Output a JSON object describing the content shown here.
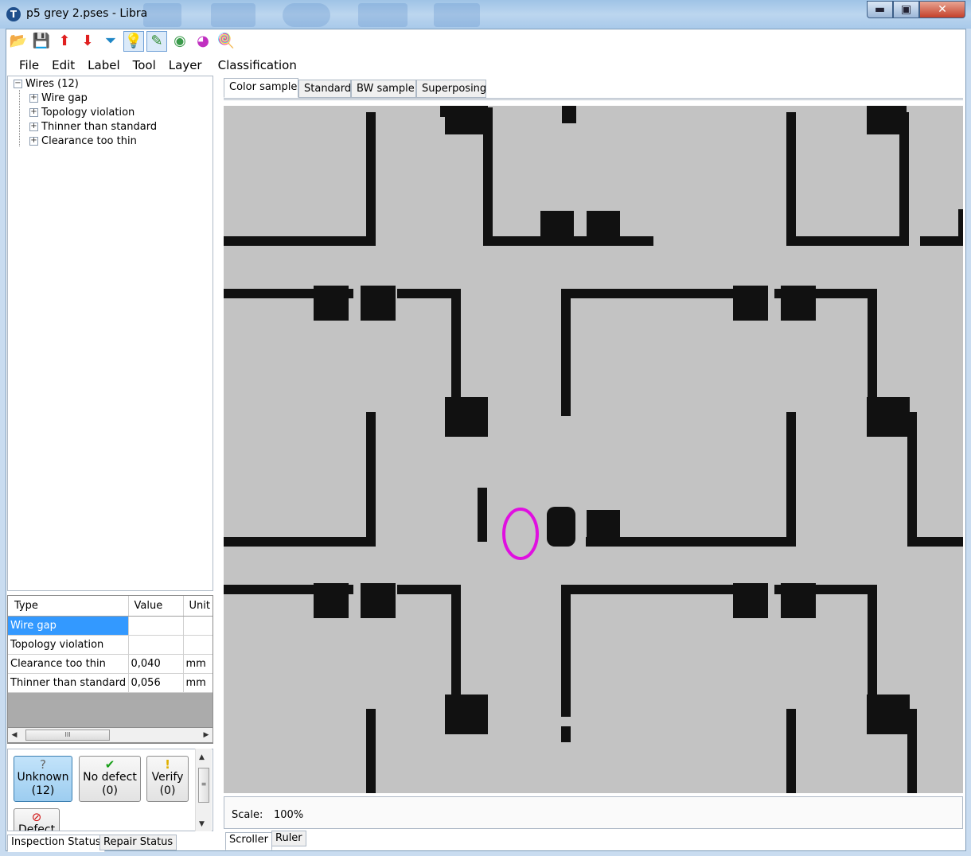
{
  "window": {
    "title": "p5 grey 2.pses - Libra",
    "min_glyph": "▬",
    "max_glyph": "▣",
    "close_glyph": "✕"
  },
  "toolbar": [
    {
      "icon": "open-folder-icon",
      "glyph": "📂",
      "color": "#e0a100"
    },
    {
      "icon": "save-icon",
      "glyph": "💾",
      "color": "#333"
    },
    {
      "icon": "arrow-up-icon",
      "glyph": "⬆",
      "color": "#e02020"
    },
    {
      "icon": "arrow-down-icon",
      "glyph": "⬇",
      "color": "#e02020"
    },
    {
      "icon": "filter-icon",
      "glyph": "⏷",
      "color": "#1e86c6"
    },
    {
      "icon": "lightbulb-icon",
      "glyph": "💡",
      "color": "#e6b800",
      "active": true
    },
    {
      "icon": "pencil-icon",
      "glyph": "✎",
      "color": "#2e8b2e",
      "active": true
    },
    {
      "icon": "color-circles-icon",
      "glyph": "◉",
      "color": "#3a9a4a"
    },
    {
      "icon": "color-wheel-icon",
      "glyph": "◕",
      "color": "#c030c0"
    },
    {
      "icon": "lollipop-icon",
      "glyph": "🍭",
      "color": "#d03030"
    }
  ],
  "menu": [
    "File",
    "Edit",
    "Label",
    "Tool",
    "Layer",
    "Classification"
  ],
  "tree": {
    "root": "Wires (12)",
    "children": [
      "Wire gap",
      "Topology violation",
      "Thinner than standard",
      "Clearance too thin"
    ]
  },
  "props": {
    "headers": [
      "Type",
      "Value",
      "Unit"
    ],
    "rows": [
      [
        "Wire gap",
        "",
        ""
      ],
      [
        "Topology violation",
        "",
        ""
      ],
      [
        "Clearance too thin",
        "0,040",
        "mm"
      ],
      [
        "Thinner than standard",
        "0,056",
        "mm"
      ]
    ],
    "scroll_grip": "III"
  },
  "status_buttons": {
    "unknown": {
      "label": "Unknown",
      "count": "(12)",
      "icon": "question-icon",
      "glyph": "?"
    },
    "no_defect": {
      "label": "No defect",
      "count": "(0)",
      "icon": "checkmark-icon",
      "glyph": "✔"
    },
    "verify": {
      "label": "Verify",
      "count": "(0)",
      "icon": "exclamation-icon",
      "glyph": "!"
    },
    "defect": {
      "label": "Defect",
      "icon": "no-entry-icon",
      "glyph": "⊘"
    }
  },
  "left_tabs": [
    "Inspection Status",
    "Repair Status"
  ],
  "view_tabs": [
    "Color sample",
    "Standard",
    "BW sample",
    "Superposing"
  ],
  "scale": {
    "label": "Scale:",
    "value": "100%"
  },
  "bottom_tabs": [
    "Scroller",
    "Ruler"
  ],
  "colors": {
    "highlight": "#3399ff",
    "defect_marker": "#e010e0",
    "board": "#c3c3c3",
    "trace": "#111111"
  }
}
